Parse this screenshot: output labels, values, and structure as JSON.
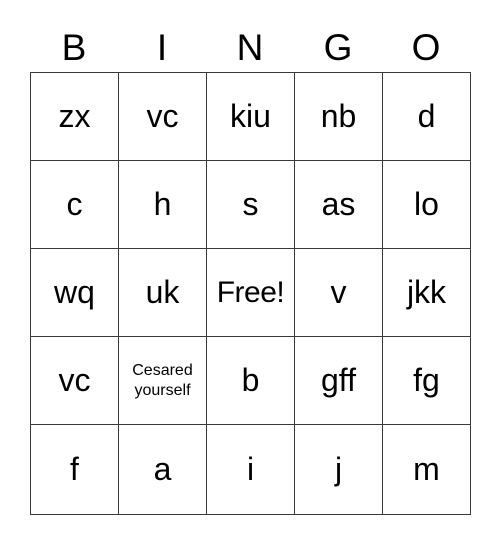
{
  "card": {
    "headers": [
      "B",
      "I",
      "N",
      "G",
      "O"
    ],
    "rows": [
      [
        {
          "text": "zx",
          "size": "large"
        },
        {
          "text": "vc",
          "size": "large"
        },
        {
          "text": "kiu",
          "size": "large"
        },
        {
          "text": "nb",
          "size": "large"
        },
        {
          "text": "d",
          "size": "large"
        }
      ],
      [
        {
          "text": "c",
          "size": "large"
        },
        {
          "text": "h",
          "size": "large"
        },
        {
          "text": "s",
          "size": "large"
        },
        {
          "text": "as",
          "size": "large"
        },
        {
          "text": "lo",
          "size": "large"
        }
      ],
      [
        {
          "text": "wq",
          "size": "large"
        },
        {
          "text": "uk",
          "size": "large"
        },
        {
          "text": "Free!",
          "size": "fit"
        },
        {
          "text": "v",
          "size": "large"
        },
        {
          "text": "jkk",
          "size": "large"
        }
      ],
      [
        {
          "text": "vc",
          "size": "large"
        },
        {
          "text": "Cesared yourself",
          "size": "small"
        },
        {
          "text": "b",
          "size": "large"
        },
        {
          "text": "gff",
          "size": "large"
        },
        {
          "text": "fg",
          "size": "large"
        }
      ],
      [
        {
          "text": "f",
          "size": "large"
        },
        {
          "text": "a",
          "size": "large"
        },
        {
          "text": "i",
          "size": "large"
        },
        {
          "text": "j",
          "size": "large"
        },
        {
          "text": "m",
          "size": "large"
        }
      ]
    ]
  },
  "colors": {
    "background": "#ffffff",
    "text": "#000000",
    "border": "#3a3a3a"
  }
}
